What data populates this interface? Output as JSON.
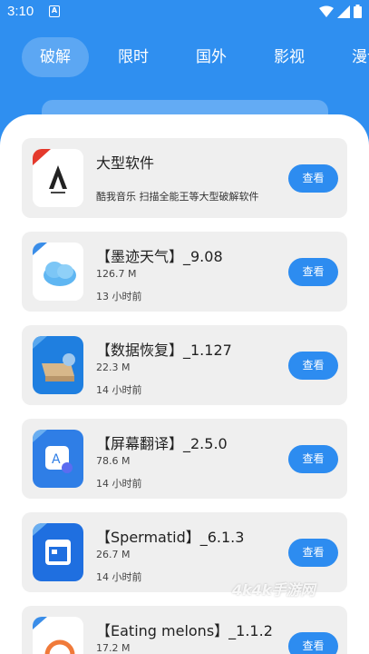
{
  "status_bar": {
    "time": "3:10",
    "notification_letter": "A"
  },
  "tabs": [
    {
      "label": "破解",
      "active": true
    },
    {
      "label": "限时",
      "active": false
    },
    {
      "label": "国外",
      "active": false
    },
    {
      "label": "影视",
      "active": false
    },
    {
      "label": "漫说",
      "active": false
    }
  ],
  "apps": [
    {
      "title": "大型软件",
      "desc": "酷我音乐 扫描全能王等大型破解软件",
      "button": "查看",
      "icon": "brand-a-logo-icon"
    },
    {
      "title": "【墨迹天气】_9.08",
      "size": "126.7 M",
      "time": "13 小时前",
      "button": "查看",
      "icon": "cloud-icon"
    },
    {
      "title": "【数据恢复】_1.127",
      "size": "22.3 M",
      "time": "14 小时前",
      "button": "查看",
      "icon": "disk-icon"
    },
    {
      "title": "【屏幕翻译】_2.5.0",
      "size": "78.6 M",
      "time": "14 小时前",
      "button": "查看",
      "icon": "translate-icon"
    },
    {
      "title": "【Spermatid】_6.1.3",
      "size": "26.7 M",
      "time": "14 小时前",
      "button": "查看",
      "icon": "calendar-icon"
    },
    {
      "title": "【Eating melons】_1.1.2",
      "size": "17.2 M",
      "time": "",
      "button": "查看",
      "icon": "melon-icon"
    }
  ],
  "watermark": "4k4k手游网",
  "colors": {
    "accent": "#2f8ff0",
    "card_bg": "#efefef",
    "button": "#2d8cf0"
  }
}
